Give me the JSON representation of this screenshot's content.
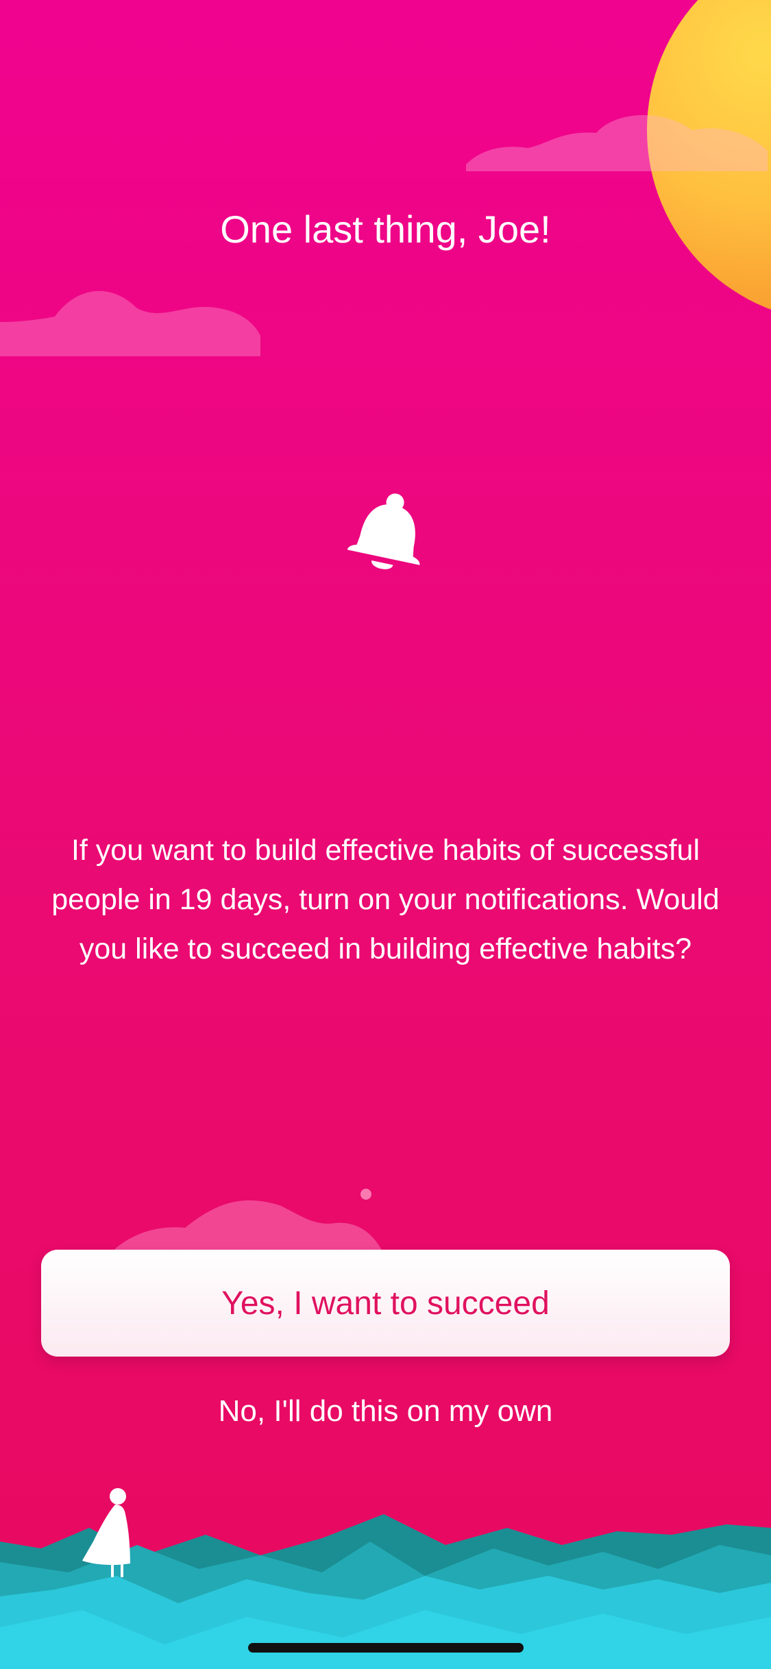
{
  "screen": {
    "title": "One last thing, Joe!",
    "message": "If you want to build effective habits of successful people in 19 days, turn on your notifications. Would you like to succeed in building effective habits?",
    "primary_button_label": "Yes, I want to succeed",
    "secondary_button_label": "No, I'll do this on my own"
  },
  "icons": {
    "bell": "bell-icon",
    "figure": "person-figure-icon"
  },
  "colors": {
    "background_top": "#f0038f",
    "background_bottom": "#e80a5e",
    "sun": "#ffc23f",
    "primary_text": "#e0115f",
    "water_light": "#2ccfe0",
    "water_dark": "#1a8f93"
  }
}
